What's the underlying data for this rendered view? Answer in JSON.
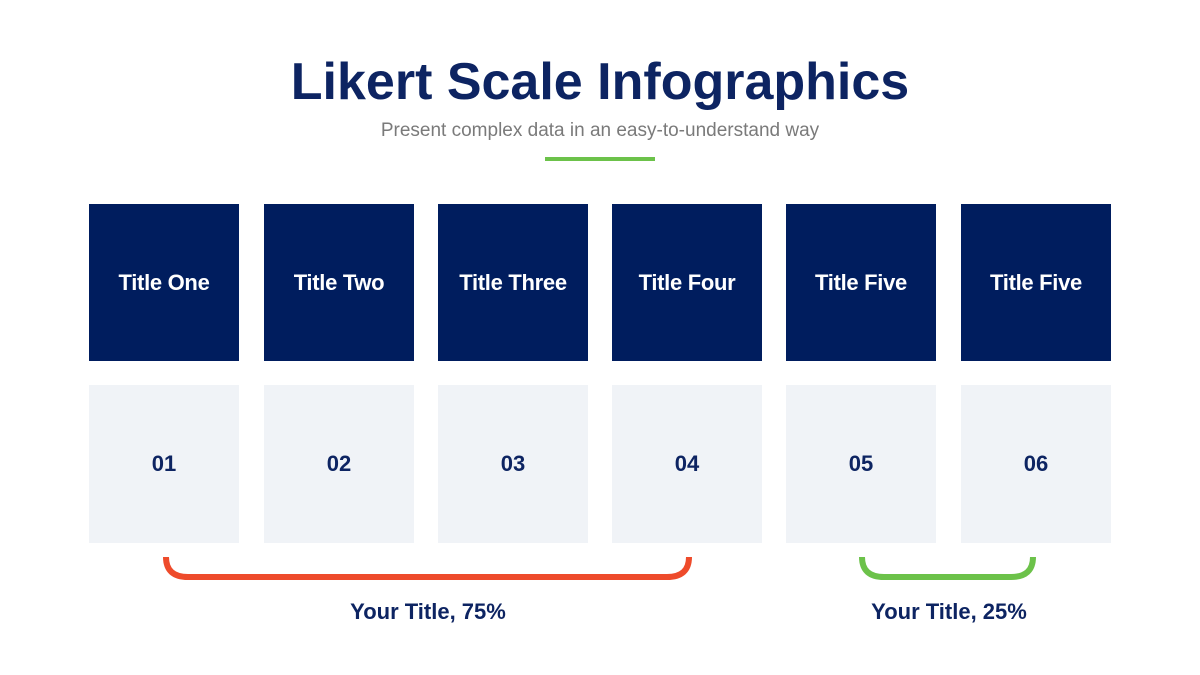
{
  "header": {
    "title": "Likert Scale Infographics",
    "subtitle": "Present complex data in an easy-to-understand way"
  },
  "colors": {
    "navy": "#001d5e",
    "text_navy": "#0d2462",
    "light_box": "#f0f3f7",
    "accent_green": "#6cc24a",
    "bracket_red": "#ee4b2b",
    "bracket_green": "#6cc24a"
  },
  "scale": [
    {
      "title": "Title One",
      "number": "01"
    },
    {
      "title": "Title Two",
      "number": "02"
    },
    {
      "title": "Title Three",
      "number": "03"
    },
    {
      "title": "Title Four",
      "number": "04"
    },
    {
      "title": "Title Five",
      "number": "05"
    },
    {
      "title": "Title Five",
      "number": "06"
    }
  ],
  "groups": [
    {
      "label": "Your Title, 75%",
      "percent": 75,
      "spans_items": [
        "01",
        "02",
        "03",
        "04"
      ],
      "color": "#ee4b2b"
    },
    {
      "label": "Your Title, 25%",
      "percent": 25,
      "spans_items": [
        "05",
        "06"
      ],
      "color": "#6cc24a"
    }
  ]
}
